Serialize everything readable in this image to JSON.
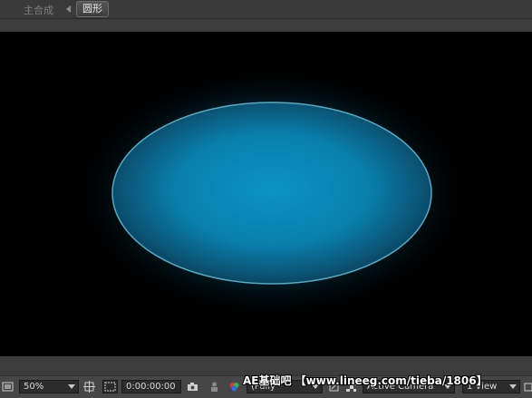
{
  "breadcrumb": {
    "parent": "主合成",
    "current": "圆形"
  },
  "viewer": {
    "background": "#000000",
    "ellipse": {
      "fill_center": "#0a93c4",
      "fill_edge": "#0b3c57",
      "stroke": "#5aa7c0",
      "glow": "#0a7fb0"
    }
  },
  "toolbar": {
    "zoom": "50%",
    "timecode": "0:00:00:00",
    "quality": "(Fully",
    "camera": "Active Camera",
    "views": "1 View"
  },
  "watermark": "AE基础吧  【www.lineeg.com/tieba/1806】"
}
